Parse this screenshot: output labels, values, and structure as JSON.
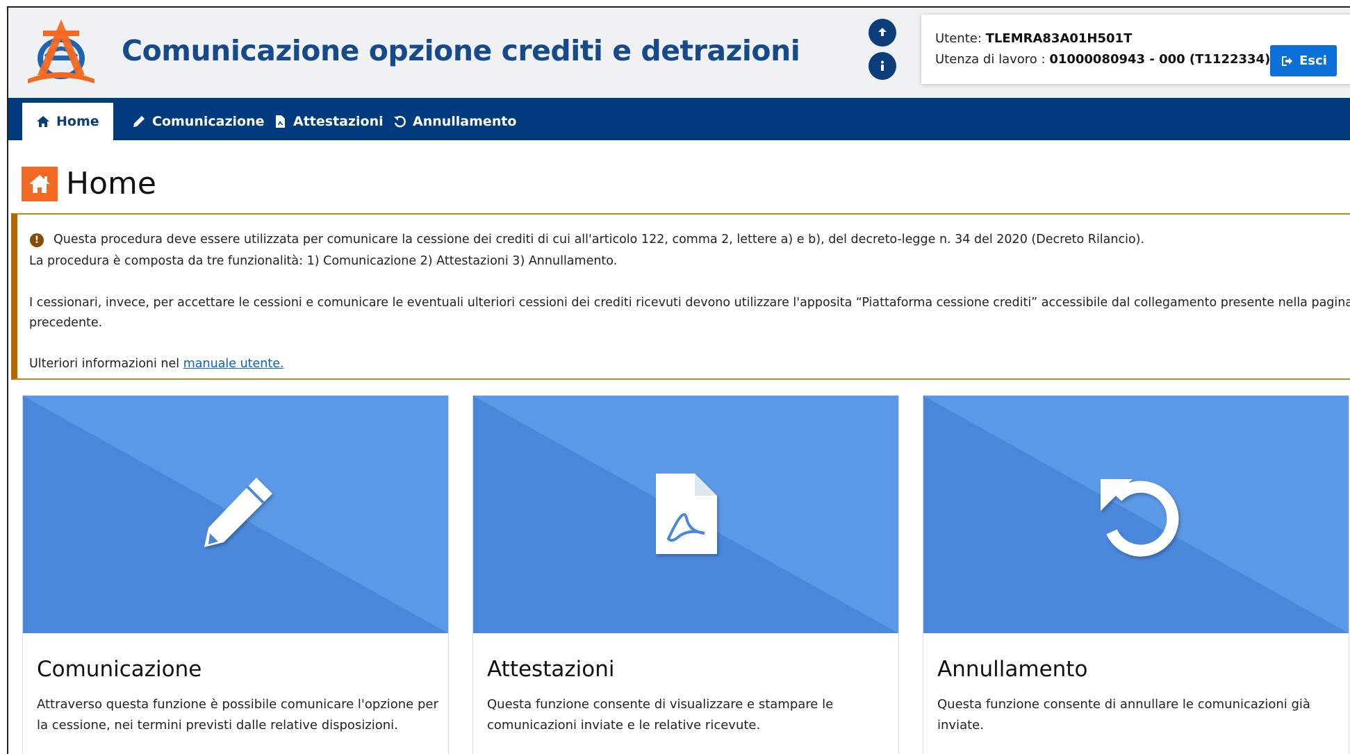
{
  "header": {
    "app_title": "Comunicazione opzione crediti e detrazioni",
    "upload_icon": "upload-circle-icon",
    "info_icon": "info-circle-icon",
    "user_label": "Utente:",
    "user_code": "TLEMRA83A01H501T",
    "workspace_label": "Utenza di lavoro :",
    "workspace_value": "01000080943 - 000 (T1122334)",
    "logout_label": "Esci"
  },
  "nav": {
    "items": [
      {
        "label": "Home",
        "icon": "home-icon",
        "active": true
      },
      {
        "label": "Comunicazione",
        "icon": "pencil-icon",
        "active": false
      },
      {
        "label": "Attestazioni",
        "icon": "pdf-file-icon",
        "active": false
      },
      {
        "label": "Annullamento",
        "icon": "undo-icon",
        "active": false
      }
    ]
  },
  "page": {
    "title": "Home"
  },
  "alert": {
    "line1": "Questa procedura deve essere utilizzata per comunicare la cessione dei crediti di cui all'articolo 122, comma 2, lettere a) e b), del decreto-legge n. 34 del 2020 (Decreto Rilancio).",
    "line2": "La procedura è composta da tre funzionalità: 1) Comunicazione 2) Attestazioni 3) Annullamento.",
    "line3": "I cessionari, invece, per accettare le cessioni e comunicare le eventuali ulteriori cessioni dei crediti ricevuti devono utilizzare l'apposita “Piattaforma cessione crediti” accessibile dal collegamento presente nella pagina",
    "line4": "precedente.",
    "info_prefix": "Ulteriori informazioni nel ",
    "manual_link": "manuale utente."
  },
  "cards": [
    {
      "title": "Comunicazione",
      "desc_1": "Attraverso questa funzione è possibile comunicare l'opzione per",
      "desc_2": "la cessione, nei termini previsti dalle relative disposizioni.",
      "icon": "pencil-icon"
    },
    {
      "title": "Attestazioni",
      "desc_1": "Questa funzione consente di visualizzare e stampare le",
      "desc_2": "comunicazioni inviate e le relative ricevute.",
      "icon": "pdf-file-icon"
    },
    {
      "title": "Annullamento",
      "desc_1": "Questa funzione consente di annullare le comunicazioni già",
      "desc_2": "inviate.",
      "icon": "undo-icon"
    }
  ],
  "colors": {
    "nav_bg": "#003b7d",
    "title_blue": "#174a8a",
    "accent_orange": "#f26a21",
    "alert_border": "#b26a00",
    "card_blue": "#4a87db",
    "logout_blue": "#0b6fd8"
  }
}
